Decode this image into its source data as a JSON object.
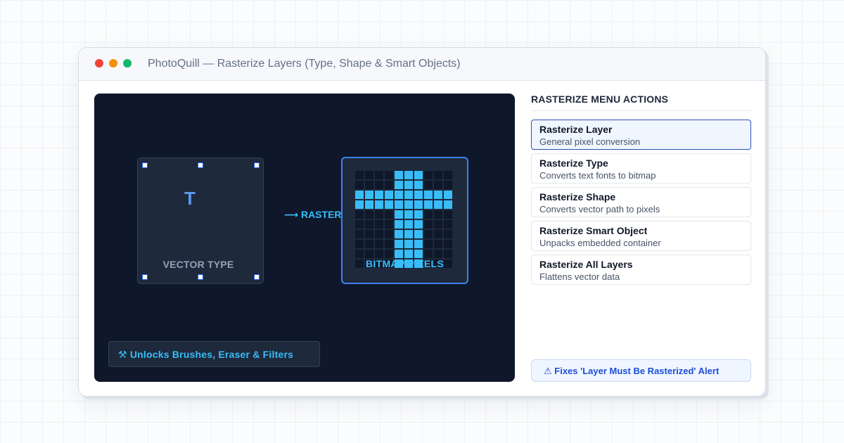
{
  "window": {
    "title": "PhotoQuill — Rasterize Layers (Type, Shape & Smart Objects)"
  },
  "canvas": {
    "vector_glyph": "T",
    "vector_label": "VECTOR TYPE",
    "arrow_label": "⟶ RASTERIZE",
    "bitmap_label": "BITMAP PIXELS",
    "unlocks_label": "⚒ Unlocks Brushes, Eraser & Filters",
    "bitmap_rows": [
      "0000111000",
      "0000111000",
      "1111111111",
      "1111111111",
      "0000111000",
      "0000111000",
      "0000111000",
      "0000111000",
      "0000111000",
      "0000111000"
    ]
  },
  "panel": {
    "title": "RASTERIZE MENU ACTIONS",
    "actions": [
      {
        "name": "Rasterize Layer",
        "desc": "General pixel conversion",
        "selected": true
      },
      {
        "name": "Rasterize Type",
        "desc": "Converts text fonts to bitmap",
        "selected": false
      },
      {
        "name": "Rasterize Shape",
        "desc": "Converts vector path to pixels",
        "selected": false
      },
      {
        "name": "Rasterize Smart Object",
        "desc": "Unpacks embedded container",
        "selected": false
      },
      {
        "name": "Rasterize All Layers",
        "desc": "Flattens vector data",
        "selected": false
      }
    ],
    "alert": "⚠ Fixes 'Layer Must Be Rasterized' Alert"
  },
  "colors": {
    "canvas_bg": "#0f172a",
    "accent": "#38bdf8",
    "selection": "#2563eb",
    "traffic_red": "#f04438",
    "traffic_yellow": "#f79009",
    "traffic_green": "#12b76a"
  }
}
